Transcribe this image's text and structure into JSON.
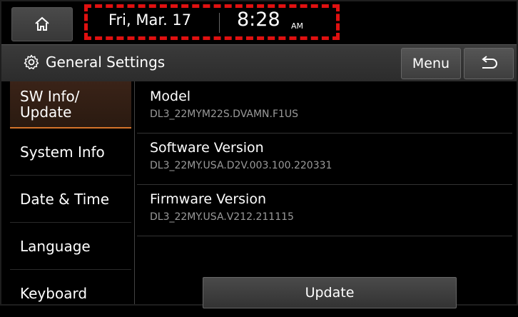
{
  "status_bar": {
    "date": "Fri, Mar. 17",
    "time": "8:28",
    "ampm": "AM"
  },
  "header": {
    "title": "General Settings",
    "menu_label": "Menu"
  },
  "sidebar": {
    "items": [
      {
        "label_line1": "SW Info/",
        "label_line2": "Update",
        "active": true
      },
      {
        "label": "System Info"
      },
      {
        "label": "Date & Time"
      },
      {
        "label": "Language"
      },
      {
        "label": "Keyboard"
      }
    ]
  },
  "main": {
    "rows": [
      {
        "title": "Model",
        "value": "DL3_22MYM22S.DVAMN.F1US"
      },
      {
        "title": "Software Version",
        "value": "DL3_22MY.USA.D2V.003.100.220331"
      },
      {
        "title": "Firmware Version",
        "value": "DL3_22MY.USA.V212.211115"
      }
    ],
    "update_label": "Update"
  },
  "icons": {
    "home": "home-icon",
    "gear": "gear-icon",
    "back": "back-arrow-icon"
  },
  "colors": {
    "highlight_border": "#e01010",
    "active_underline": "#d4742a"
  }
}
